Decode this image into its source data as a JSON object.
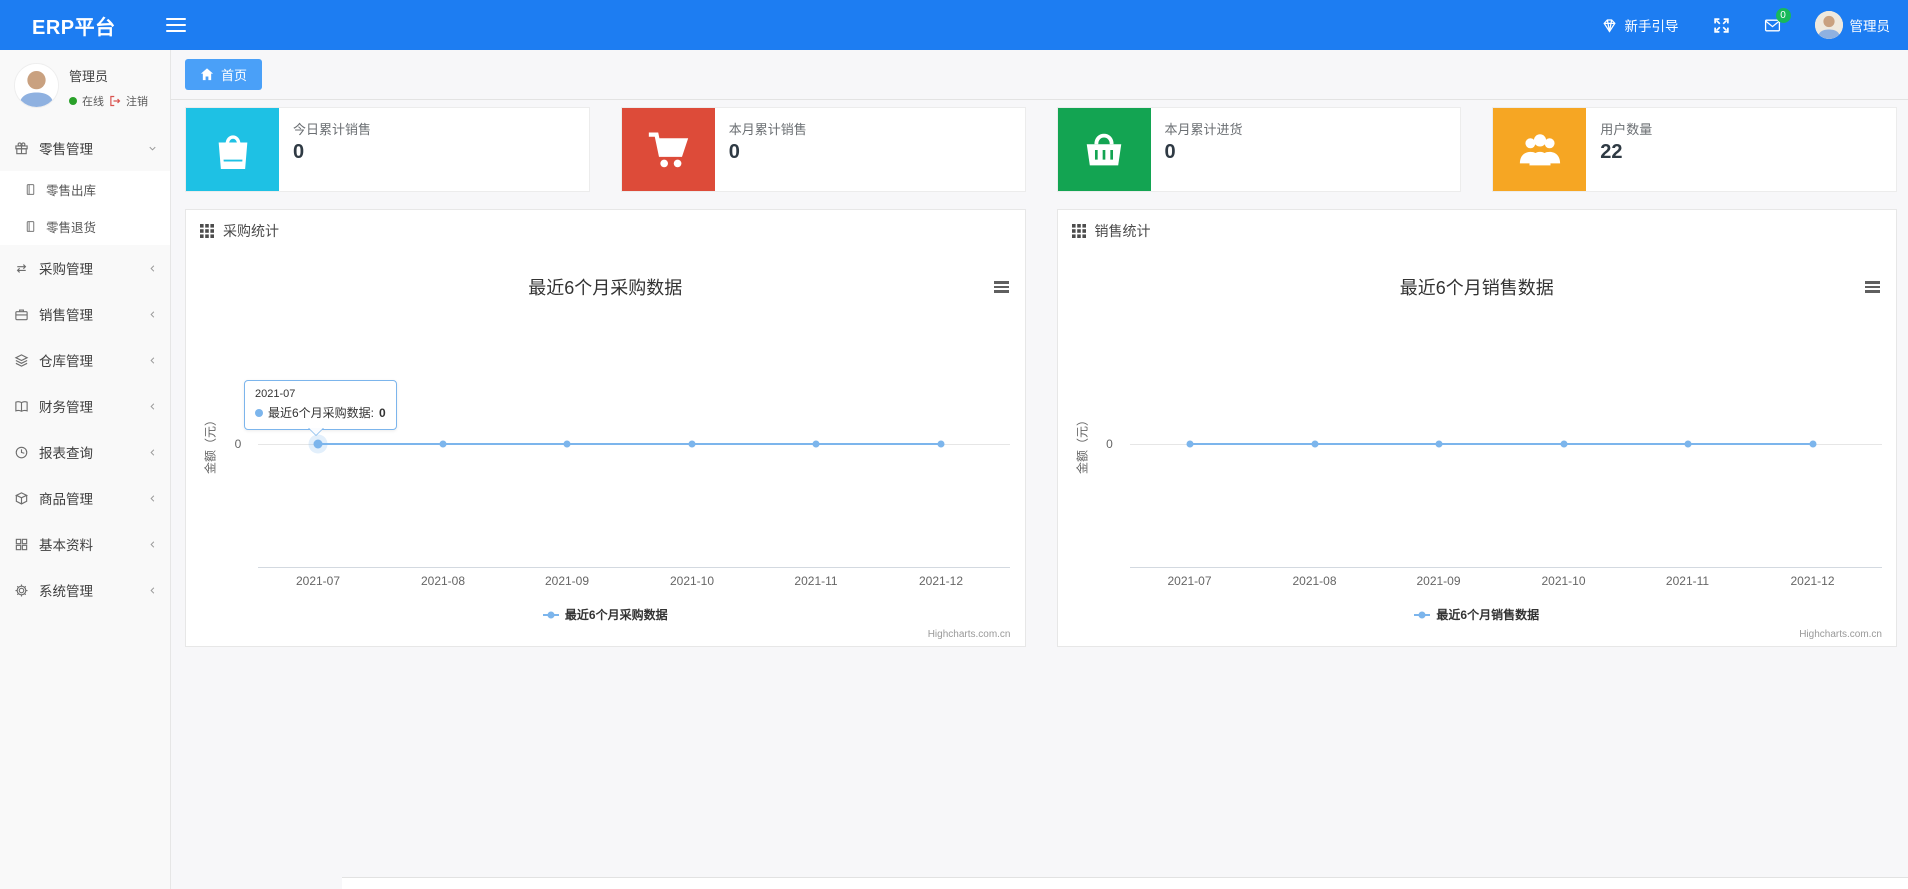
{
  "colors": {
    "navbar": "#1d7df2",
    "breadcrumb_tab": "#4aa0f8",
    "badge": "#18b95a",
    "online": "#2aa12a",
    "logout": "#d9534f"
  },
  "navbar": {
    "brand": "ERP平台",
    "guide_label": "新手引导",
    "mail_badge": "0",
    "username": "管理员"
  },
  "sidebar": {
    "user": {
      "name": "管理员",
      "status": "在线",
      "logout": "注销"
    },
    "items": [
      {
        "label": "零售管理",
        "icon": "gift-icon",
        "state": "expanded",
        "children": [
          {
            "label": "零售出库"
          },
          {
            "label": "零售退货"
          }
        ]
      },
      {
        "label": "采购管理",
        "icon": "repeat-icon"
      },
      {
        "label": "销售管理",
        "icon": "briefcase-icon"
      },
      {
        "label": "仓库管理",
        "icon": "layers-icon"
      },
      {
        "label": "财务管理",
        "icon": "book-icon"
      },
      {
        "label": "报表查询",
        "icon": "clock-icon"
      },
      {
        "label": "商品管理",
        "icon": "box-icon"
      },
      {
        "label": "基本资料",
        "icon": "grid-icon"
      },
      {
        "label": "系统管理",
        "icon": "gear-icon"
      }
    ]
  },
  "breadcrumb": {
    "home": "首页"
  },
  "cards": [
    {
      "title": "今日累计销售",
      "value": "0",
      "color": "#1ec1e4",
      "icon": "shopping-bag-icon"
    },
    {
      "title": "本月累计销售",
      "value": "0",
      "color": "#dd4b39",
      "icon": "shopping-cart-icon"
    },
    {
      "title": "本月累计进货",
      "value": "0",
      "color": "#13a452",
      "icon": "shopping-basket-icon"
    },
    {
      "title": "用户数量",
      "value": "22",
      "color": "#f6a623",
      "icon": "users-icon"
    }
  ],
  "chart_data": [
    {
      "type": "line",
      "panel_title": "采购统计",
      "title": "最近6个月采购数据",
      "categories": [
        "2021-07",
        "2021-08",
        "2021-09",
        "2021-10",
        "2021-11",
        "2021-12"
      ],
      "series": [
        {
          "name": "最近6个月采购数据",
          "values": [
            0,
            0,
            0,
            0,
            0,
            0
          ]
        }
      ],
      "ylabel": "金额（元）",
      "ytick": "0",
      "ylim": [
        0,
        0
      ],
      "grid": "on",
      "legend": "最近6个月采购数据",
      "legend_position": "bottom",
      "credits": "Highcharts.com.cn",
      "line_color": "#7cb5ec",
      "tooltip": {
        "header": "2021-07",
        "label": "最近6个月采购数据:",
        "value": "0"
      }
    },
    {
      "type": "line",
      "panel_title": "销售统计",
      "title": "最近6个月销售数据",
      "categories": [
        "2021-07",
        "2021-08",
        "2021-09",
        "2021-10",
        "2021-11",
        "2021-12"
      ],
      "series": [
        {
          "name": "最近6个月销售数据",
          "values": [
            0,
            0,
            0,
            0,
            0,
            0
          ]
        }
      ],
      "ylabel": "金额（元）",
      "ytick": "0",
      "ylim": [
        0,
        0
      ],
      "grid": "on",
      "legend": "最近6个月销售数据",
      "legend_position": "bottom",
      "credits": "Highcharts.com.cn",
      "line_color": "#7cb5ec"
    }
  ]
}
